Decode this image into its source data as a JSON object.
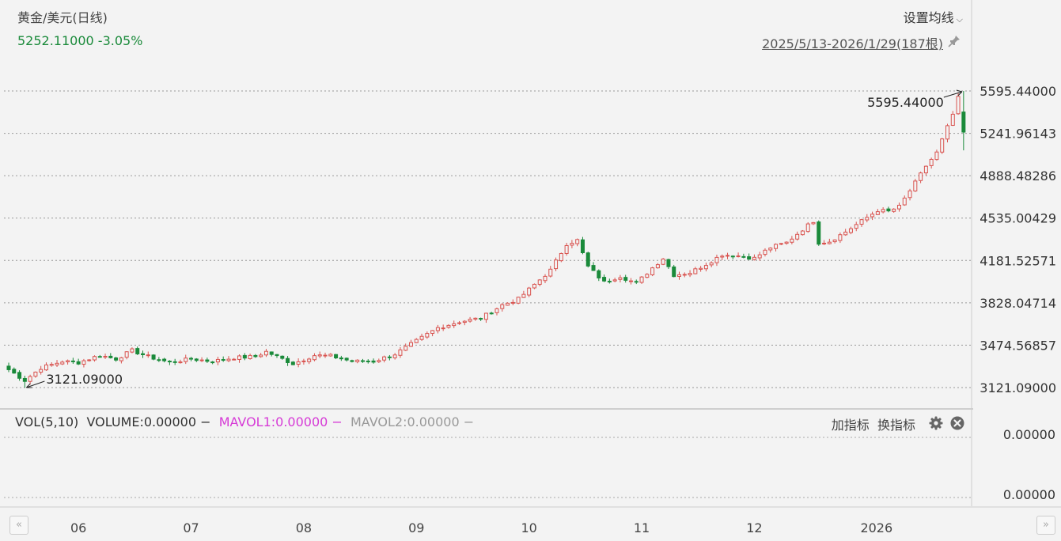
{
  "header": {
    "title": "黄金/美元(日线)",
    "last_price": "5252.11000 -3.05%",
    "settings_label": "设置均线",
    "range_label": "2025/5/13-2026/1/29(187根)"
  },
  "volume_panel": {
    "label": "VOL(5,10)",
    "volume": "VOLUME:0.00000",
    "mavol1": "MAVOL1:0.00000",
    "mavol2": "MAVOL2:0.00000",
    "dash": "−",
    "add_indicator": "加指标",
    "switch_indicator": "换指标",
    "axis_top": "0.00000",
    "axis_bottom": "0.00000"
  },
  "icons": {
    "pin": "pin-icon",
    "gear": "gear-icon",
    "close": "close-circle-icon",
    "nav_left": "double-chevron-left-icon",
    "nav_right": "double-chevron-right-icon",
    "chevron": "chevron-down-icon"
  },
  "colors": {
    "up": "#d9534f",
    "down": "#1a8a3a",
    "grid": "#9a9a9a"
  },
  "chart_data": {
    "type": "candlestick",
    "series_name": "黄金/美元",
    "period": "日线",
    "y_ticks": [
      "5595.44000",
      "5241.96143",
      "4888.48286",
      "4535.00429",
      "4181.52571",
      "3828.04714",
      "3474.56857",
      "3121.09000"
    ],
    "ylim": [
      3121.09,
      5595.44
    ],
    "x_month_labels": [
      "06",
      "07",
      "08",
      "09",
      "10",
      "11",
      "12",
      "2026"
    ],
    "x_month_bar_index": [
      13,
      34,
      55,
      76,
      97,
      118,
      139,
      160
    ],
    "bar_count": 187,
    "annotations": [
      {
        "text": "5595.44000",
        "kind": "high"
      },
      {
        "text": "3121.09000",
        "kind": "low"
      }
    ],
    "grid": true,
    "anchors": [
      [
        0,
        3270
      ],
      [
        3,
        3180
      ],
      [
        6,
        3285
      ],
      [
        10,
        3340
      ],
      [
        13,
        3330
      ],
      [
        17,
        3390
      ],
      [
        20,
        3360
      ],
      [
        23,
        3430
      ],
      [
        26,
        3380
      ],
      [
        30,
        3330
      ],
      [
        34,
        3360
      ],
      [
        38,
        3340
      ],
      [
        42,
        3370
      ],
      [
        46,
        3380
      ],
      [
        48,
        3420
      ],
      [
        53,
        3320
      ],
      [
        57,
        3390
      ],
      [
        60,
        3385
      ],
      [
        64,
        3340
      ],
      [
        68,
        3340
      ],
      [
        72,
        3400
      ],
      [
        76,
        3510
      ],
      [
        80,
        3620
      ],
      [
        84,
        3670
      ],
      [
        88,
        3700
      ],
      [
        92,
        3810
      ],
      [
        95,
        3860
      ],
      [
        98,
        3980
      ],
      [
        101,
        4100
      ],
      [
        104,
        4320
      ],
      [
        106,
        4350
      ],
      [
        108,
        4130
      ],
      [
        111,
        4000
      ],
      [
        114,
        4050
      ],
      [
        117,
        3990
      ],
      [
        120,
        4120
      ],
      [
        122,
        4200
      ],
      [
        124,
        4060
      ],
      [
        127,
        4080
      ],
      [
        130,
        4150
      ],
      [
        133,
        4230
      ],
      [
        136,
        4220
      ],
      [
        139,
        4200
      ],
      [
        142,
        4290
      ],
      [
        145,
        4330
      ],
      [
        148,
        4440
      ],
      [
        150,
        4510
      ],
      [
        151,
        4330
      ],
      [
        153,
        4340
      ],
      [
        156,
        4420
      ],
      [
        159,
        4510
      ],
      [
        162,
        4600
      ],
      [
        164,
        4590
      ],
      [
        166,
        4630
      ],
      [
        169,
        4830
      ],
      [
        171,
        4970
      ],
      [
        173,
        5080
      ],
      [
        176,
        5400
      ],
      [
        177,
        5550
      ]
    ],
    "last_close": 5252.11
  }
}
